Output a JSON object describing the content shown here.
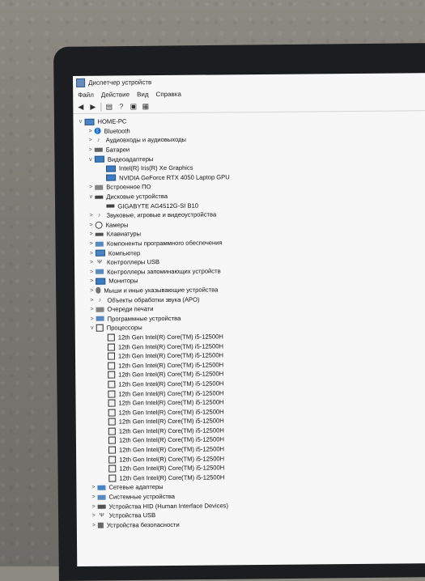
{
  "window": {
    "title": "Диспетчер устройств"
  },
  "menu": [
    "Файл",
    "Действие",
    "Вид",
    "Справка"
  ],
  "toolbar": {
    "back_icon": "arrow-left-icon",
    "forward_icon": "arrow-right-icon",
    "properties_icon": "properties-icon",
    "help_icon": "help-icon",
    "update_icon": "update-driver-icon",
    "scan_icon": "scan-hardware-icon"
  },
  "tree": {
    "root": "HOME-PC",
    "items": [
      {
        "label": "Bluetooth",
        "level": 1,
        "chev": ">",
        "icon": "bt"
      },
      {
        "label": "Аудиовходы и аудиовыходы",
        "level": 1,
        "chev": ">",
        "icon": "audio"
      },
      {
        "label": "Батареи",
        "level": 1,
        "chev": ">",
        "icon": "battery"
      },
      {
        "label": "Видеоадаптеры",
        "level": 1,
        "chev": "v",
        "icon": "display"
      },
      {
        "label": "Intel(R) Iris(R) Xe Graphics",
        "level": 2,
        "chev": "",
        "icon": "display"
      },
      {
        "label": "NVIDIA GeForce RTX 4050 Laptop GPU",
        "level": 2,
        "chev": "",
        "icon": "display"
      },
      {
        "label": "Встроенное ПО",
        "level": 1,
        "chev": ">",
        "icon": "firmware"
      },
      {
        "label": "Дисковые устройства",
        "level": 1,
        "chev": "v",
        "icon": "disk"
      },
      {
        "label": "GIGABYTE AG4512G-SI B10",
        "level": 2,
        "chev": "",
        "icon": "disk"
      },
      {
        "label": "Звуковые, игровые и видеоустройства",
        "level": 1,
        "chev": ">",
        "icon": "audio"
      },
      {
        "label": "Камеры",
        "level": 1,
        "chev": ">",
        "icon": "camera"
      },
      {
        "label": "Клавиатуры",
        "level": 1,
        "chev": ">",
        "icon": "keyboard"
      },
      {
        "label": "Компоненты программного обеспечения",
        "level": 1,
        "chev": ">",
        "icon": "generic"
      },
      {
        "label": "Компьютер",
        "level": 1,
        "chev": ">",
        "icon": "computer"
      },
      {
        "label": "Контроллеры USB",
        "level": 1,
        "chev": ">",
        "icon": "usb"
      },
      {
        "label": "Контроллеры запоминающих устройств",
        "level": 1,
        "chev": ">",
        "icon": "generic"
      },
      {
        "label": "Мониторы",
        "level": 1,
        "chev": ">",
        "icon": "display"
      },
      {
        "label": "Мыши и иные указывающие устройства",
        "level": 1,
        "chev": ">",
        "icon": "mouse"
      },
      {
        "label": "Объекты обработки звука (APO)",
        "level": 1,
        "chev": ">",
        "icon": "audio"
      },
      {
        "label": "Очереди печати",
        "level": 1,
        "chev": ">",
        "icon": "print"
      },
      {
        "label": "Программные устройства",
        "level": 1,
        "chev": ">",
        "icon": "generic"
      },
      {
        "label": "Процессоры",
        "level": 1,
        "chev": "v",
        "icon": "cpu"
      },
      {
        "label": "12th Gen Intel(R) Core(TM) i5-12500H",
        "level": 2,
        "chev": "",
        "icon": "cpu"
      },
      {
        "label": "12th Gen Intel(R) Core(TM) i5-12500H",
        "level": 2,
        "chev": "",
        "icon": "cpu"
      },
      {
        "label": "12th Gen Intel(R) Core(TM) i5-12500H",
        "level": 2,
        "chev": "",
        "icon": "cpu"
      },
      {
        "label": "12th Gen Intel(R) Core(TM) i5-12500H",
        "level": 2,
        "chev": "",
        "icon": "cpu"
      },
      {
        "label": "12th Gen Intel(R) Core(TM) i5-12500H",
        "level": 2,
        "chev": "",
        "icon": "cpu"
      },
      {
        "label": "12th Gen Intel(R) Core(TM) i5-12500H",
        "level": 2,
        "chev": "",
        "icon": "cpu"
      },
      {
        "label": "12th Gen Intel(R) Core(TM) i5-12500H",
        "level": 2,
        "chev": "",
        "icon": "cpu"
      },
      {
        "label": "12th Gen Intel(R) Core(TM) i5-12500H",
        "level": 2,
        "chev": "",
        "icon": "cpu"
      },
      {
        "label": "12th Gen Intel(R) Core(TM) i5-12500H",
        "level": 2,
        "chev": "",
        "icon": "cpu"
      },
      {
        "label": "12th Gen Intel(R) Core(TM) i5-12500H",
        "level": 2,
        "chev": "",
        "icon": "cpu"
      },
      {
        "label": "12th Gen Intel(R) Core(TM) i5-12500H",
        "level": 2,
        "chev": "",
        "icon": "cpu"
      },
      {
        "label": "12th Gen Intel(R) Core(TM) i5-12500H",
        "level": 2,
        "chev": "",
        "icon": "cpu"
      },
      {
        "label": "12th Gen Intel(R) Core(TM) i5-12500H",
        "level": 2,
        "chev": "",
        "icon": "cpu"
      },
      {
        "label": "12th Gen Intel(R) Core(TM) i5-12500H",
        "level": 2,
        "chev": "",
        "icon": "cpu"
      },
      {
        "label": "12th Gen Intel(R) Core(TM) i5-12500H",
        "level": 2,
        "chev": "",
        "icon": "cpu"
      },
      {
        "label": "12th Gen Intel(R) Core(TM) i5-12500H",
        "level": 2,
        "chev": "",
        "icon": "cpu"
      },
      {
        "label": "Сетевые адаптеры",
        "level": 1,
        "chev": ">",
        "icon": "net"
      },
      {
        "label": "Системные устройства",
        "level": 1,
        "chev": ">",
        "icon": "generic"
      },
      {
        "label": "Устройства HID (Human Interface Devices)",
        "level": 1,
        "chev": ">",
        "icon": "hid"
      },
      {
        "label": "Устройства USB",
        "level": 1,
        "chev": ">",
        "icon": "usb"
      },
      {
        "label": "Устройства безопасности",
        "level": 1,
        "chev": ">",
        "icon": "sec"
      }
    ]
  }
}
